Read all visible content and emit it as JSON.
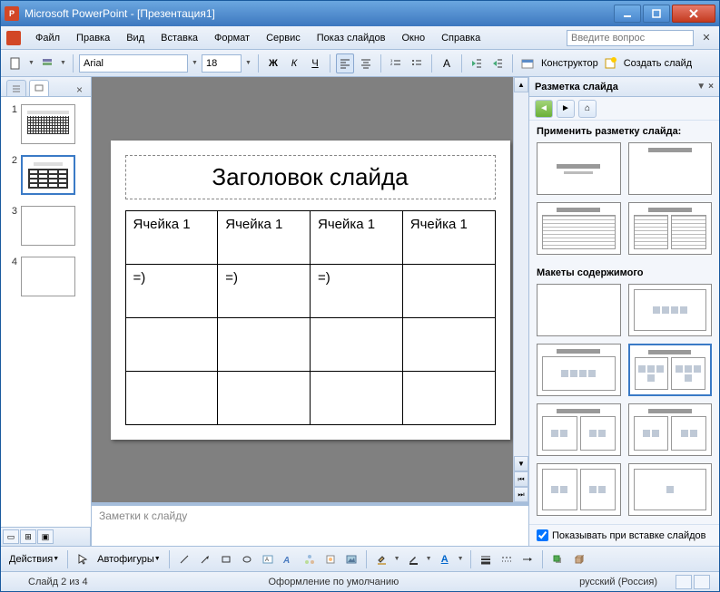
{
  "titlebar": {
    "app_name": "Microsoft PowerPoint",
    "doc_name": "[Презентация1]"
  },
  "menubar": {
    "file": "Файл",
    "edit": "Правка",
    "view": "Вид",
    "insert": "Вставка",
    "format": "Формат",
    "tools": "Сервис",
    "slideshow": "Показ слайдов",
    "window": "Окно",
    "help": "Справка",
    "help_placeholder": "Введите вопрос"
  },
  "toolbar": {
    "font_name": "Arial",
    "font_size": "18",
    "designer_label": "Конструктор",
    "new_slide_label": "Создать слайд"
  },
  "thumbnails": {
    "items": [
      {
        "num": "1"
      },
      {
        "num": "2"
      },
      {
        "num": "3"
      },
      {
        "num": "4"
      }
    ]
  },
  "slide": {
    "title": "Заголовок слайда",
    "table": {
      "rows": [
        [
          "Ячейка 1",
          "Ячейка 1",
          "Ячейка 1",
          "Ячейка 1"
        ],
        [
          "=)",
          "=)",
          "=)",
          ""
        ],
        [
          "",
          "",
          "",
          ""
        ],
        [
          "",
          "",
          "",
          ""
        ]
      ]
    }
  },
  "notes": {
    "placeholder": "Заметки к слайду"
  },
  "right_panel": {
    "title": "Разметка слайда",
    "apply_label": "Применить разметку слайда:",
    "content_layouts_label": "Макеты содержимого",
    "show_on_insert": "Показывать при вставке слайдов"
  },
  "bottom_toolbar": {
    "actions": "Действия",
    "autoshapes": "Автофигуры"
  },
  "statusbar": {
    "slide_info": "Слайд 2 из 4",
    "design": "Оформление по умолчанию",
    "language": "русский (Россия)"
  }
}
